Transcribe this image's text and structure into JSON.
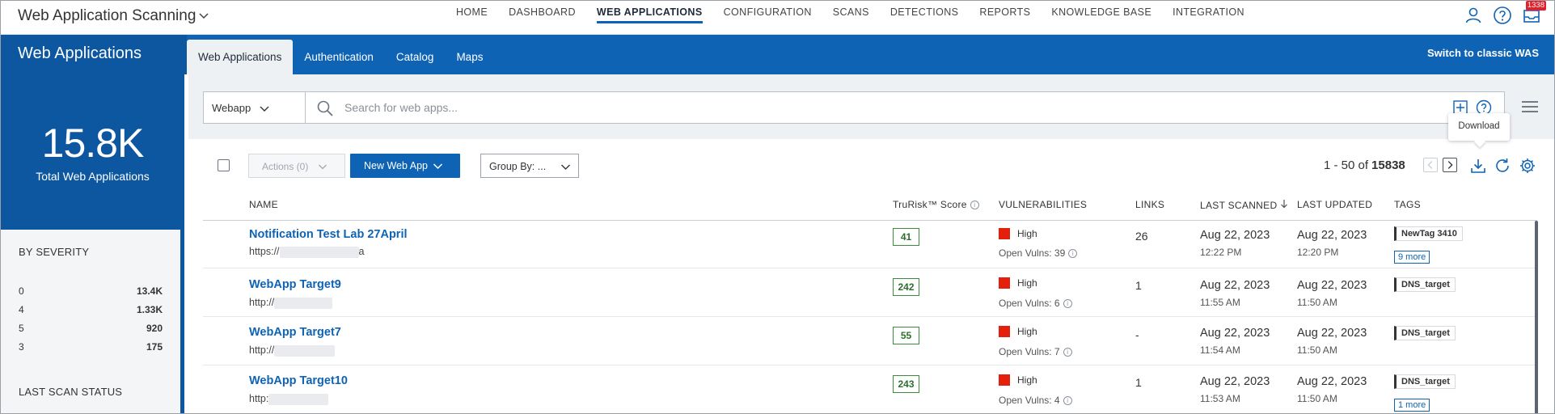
{
  "app": {
    "title": "Web Application Scanning"
  },
  "nav": {
    "items": [
      "HOME",
      "DASHBOARD",
      "WEB APPLICATIONS",
      "CONFIGURATION",
      "SCANS",
      "DETECTIONS",
      "REPORTS",
      "KNOWLEDGE BASE",
      "INTEGRATION"
    ],
    "active": "WEB APPLICATIONS"
  },
  "notifications": {
    "count": "1338"
  },
  "band": {
    "title": "Web Applications",
    "tabs": [
      "Web Applications",
      "Authentication",
      "Catalog",
      "Maps"
    ],
    "active_tab": "Web Applications",
    "classic_link": "Switch to classic WAS"
  },
  "summary": {
    "total": "15.8K",
    "caption": "Total Web Applications"
  },
  "severity": {
    "title": "BY SEVERITY",
    "rows": [
      {
        "level": "0",
        "count": "13.4K"
      },
      {
        "level": "4",
        "count": "1.33K"
      },
      {
        "level": "5",
        "count": "920"
      },
      {
        "level": "3",
        "count": "175"
      }
    ]
  },
  "scan_status": {
    "title": "LAST SCAN STATUS"
  },
  "search": {
    "type": "Webapp",
    "placeholder": "Search for web apps..."
  },
  "tooltip": {
    "text": "Download"
  },
  "toolbar": {
    "actions": "Actions (0)",
    "new_app": "New Web App",
    "group_by": "Group By: ..."
  },
  "pager": {
    "range": "1 - 50 of",
    "total": "15838"
  },
  "table": {
    "headers": {
      "name": "NAME",
      "trurisk": "TruRisk™ Score",
      "vulnerabilities": "VULNERABILITIES",
      "links": "LINKS",
      "last_scanned": "LAST SCANNED",
      "last_updated": "LAST UPDATED",
      "tags": "TAGS"
    },
    "rows": [
      {
        "name": "Notification Test Lab 27April",
        "url_prefix": "https://",
        "url_suffix": "a",
        "score": "41",
        "severity": "High",
        "open_vulns": "Open Vulns: 39",
        "links": "26",
        "scanned_date": "Aug 22, 2023",
        "scanned_time": "12:22 PM",
        "updated_date": "Aug 22, 2023",
        "updated_time": "12:20 PM",
        "tag": "NewTag 3410",
        "more": "9 more"
      },
      {
        "name": "WebApp Target9",
        "url_prefix": "http://",
        "url_suffix": "",
        "score": "242",
        "severity": "High",
        "open_vulns": "Open Vulns: 6",
        "links": "1",
        "scanned_date": "Aug 22, 2023",
        "scanned_time": "11:55 AM",
        "updated_date": "Aug 22, 2023",
        "updated_time": "11:50 AM",
        "tag": "DNS_target",
        "more": ""
      },
      {
        "name": "WebApp Target7",
        "url_prefix": "http://",
        "url_suffix": "",
        "score": "55",
        "severity": "High",
        "open_vulns": "Open Vulns: 7",
        "links": "-",
        "scanned_date": "Aug 22, 2023",
        "scanned_time": "11:54 AM",
        "updated_date": "Aug 22, 2023",
        "updated_time": "11:50 AM",
        "tag": "DNS_target",
        "more": ""
      },
      {
        "name": "WebApp Target10",
        "url_prefix": "http:",
        "url_suffix": "",
        "score": "243",
        "severity": "High",
        "open_vulns": "Open Vulns: 4",
        "links": "1",
        "scanned_date": "Aug 22, 2023",
        "scanned_time": "11:53 AM",
        "updated_date": "Aug 22, 2023",
        "updated_time": "11:50 AM",
        "tag": "DNS_target",
        "more": "1 more"
      }
    ]
  },
  "colors": {
    "brand_blue": "#0e63b5",
    "sidebar_blue": "#0d56a0",
    "severity_high": "#e4200d",
    "score_green": "#3c8a3c",
    "badge_red": "#e0202b"
  }
}
